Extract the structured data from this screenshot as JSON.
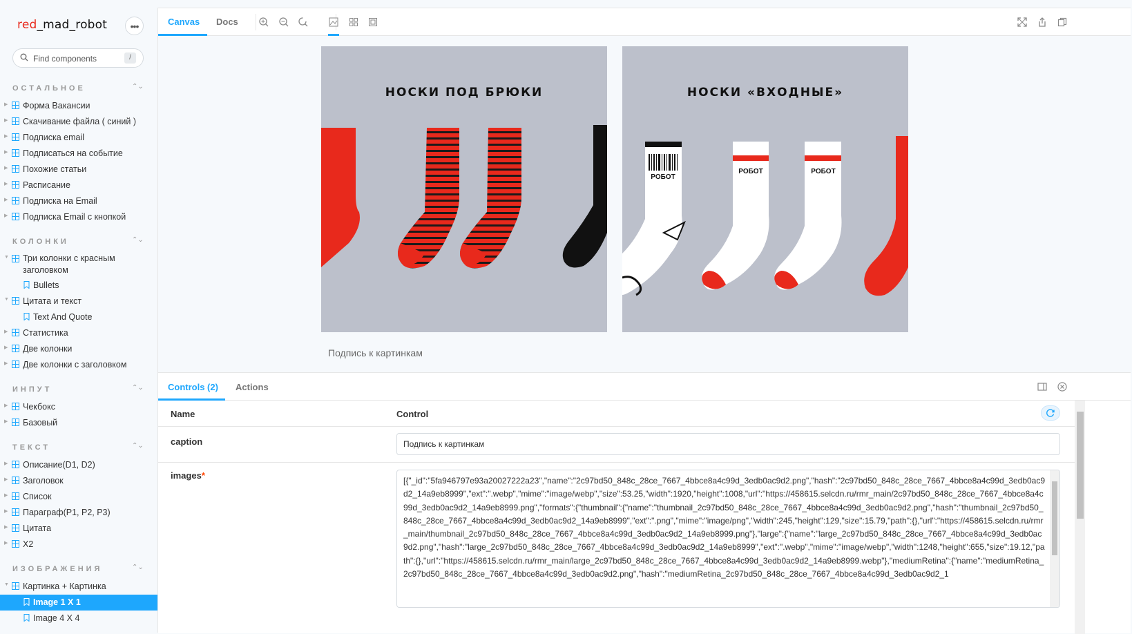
{
  "brand": {
    "p1": "red",
    "p2": "_",
    "p3": "mad",
    "p4": "_",
    "p5": "robot"
  },
  "search": {
    "placeholder": "Find components",
    "shortcut": "/"
  },
  "groups": {
    "other": "ОСТАЛЬНОЕ",
    "columns": "КОЛОНКИ",
    "input": "ИНПУТ",
    "text": "ТЕКСТ",
    "images": "ИЗОБРАЖЕНИЯ"
  },
  "items": {
    "other": [
      "Форма Вакансии",
      "Скачивание файла ( синий )",
      "Подписка email",
      "Подписаться на событие",
      "Похожие статьи",
      "Расписание",
      "Подписка на Email",
      "Подписка Email с кнопкой"
    ],
    "columns_a": "Три колонки с красным заголовком",
    "columns_a_child": "Bullets",
    "columns_b": "Цитата и текст",
    "columns_b_child": "Text And Quote",
    "columns_rest": [
      "Статистика",
      "Две колонки",
      "Две колонки с заголовком"
    ],
    "input": [
      "Чекбокс",
      "Базовый"
    ],
    "text": [
      "Описание(D1, D2)",
      "Заголовок",
      "Список",
      "Параграф(P1, P2, P3)",
      "Цитата",
      "X2"
    ],
    "images_parent": "Картинка + Картинка",
    "images_children": [
      "Image 1 X 1",
      "Image 4 X 4"
    ]
  },
  "toolbar": {
    "tab_canvas": "Canvas",
    "tab_docs": "Docs"
  },
  "canvas": {
    "left_title": "НОСКИ ПОД БРЮКИ",
    "right_title": "НОСКИ «ВХОДНЫЕ»",
    "sock_label": "РОБОТ",
    "caption": "Подпись к картинкам"
  },
  "addons": {
    "tab_controls": "Controls (2)",
    "tab_actions": "Actions",
    "col_name": "Name",
    "col_control": "Control",
    "row_caption_name": "caption",
    "row_caption_value": "Подпись к картинкам",
    "row_images_name": "images",
    "required_mark": "*",
    "row_images_value": "[{\"_id\":\"5fa946797e93a20027222a23\",\"name\":\"2c97bd50_848c_28ce_7667_4bbce8a4c99d_3edb0ac9d2.png\",\"hash\":\"2c97bd50_848c_28ce_7667_4bbce8a4c99d_3edb0ac9d2_14a9eb8999\",\"ext\":\".webp\",\"mime\":\"image/webp\",\"size\":53.25,\"width\":1920,\"height\":1008,\"url\":\"https://458615.selcdn.ru/rmr_main/2c97bd50_848c_28ce_7667_4bbce8a4c99d_3edb0ac9d2_14a9eb8999.png\",\"formats\":{\"thumbnail\":{\"name\":\"thumbnail_2c97bd50_848c_28ce_7667_4bbce8a4c99d_3edb0ac9d2.png\",\"hash\":\"thumbnail_2c97bd50_848c_28ce_7667_4bbce8a4c99d_3edb0ac9d2_14a9eb8999\",\"ext\":\".png\",\"mime\":\"image/png\",\"width\":245,\"height\":129,\"size\":15.79,\"path\":{},\"url\":\"https://458615.selcdn.ru/rmr_main/thumbnail_2c97bd50_848c_28ce_7667_4bbce8a4c99d_3edb0ac9d2_14a9eb8999.png\"},\"large\":{\"name\":\"large_2c97bd50_848c_28ce_7667_4bbce8a4c99d_3edb0ac9d2.png\",\"hash\":\"large_2c97bd50_848c_28ce_7667_4bbce8a4c99d_3edb0ac9d2_14a9eb8999\",\"ext\":\".webp\",\"mime\":\"image/webp\",\"width\":1248,\"height\":655,\"size\":19.12,\"path\":{},\"url\":\"https://458615.selcdn.ru/rmr_main/large_2c97bd50_848c_28ce_7667_4bbce8a4c99d_3edb0ac9d2_14a9eb8999.webp\"},\"mediumRetina\":{\"name\":\"mediumRetina_2c97bd50_848c_28ce_7667_4bbce8a4c99d_3edb0ac9d2.png\",\"hash\":\"mediumRetina_2c97bd50_848c_28ce_7667_4bbce8a4c99d_3edb0ac9d2_1"
  },
  "colors": {
    "accent": "#1ea7fd",
    "brand_red": "#e8291c",
    "sock_red": "#e8291c",
    "canvas_bg": "#bcc0cb"
  },
  "icons": [
    "search-icon",
    "more-icon",
    "component-icon",
    "story-icon",
    "zoom-in-icon",
    "zoom-out-icon",
    "zoom-reset-icon",
    "background-icon",
    "grid-icon",
    "outline-icon",
    "fullscreen-icon",
    "share-icon",
    "copy-link-icon",
    "panel-layout-icon",
    "close-icon",
    "reset-icon"
  ]
}
